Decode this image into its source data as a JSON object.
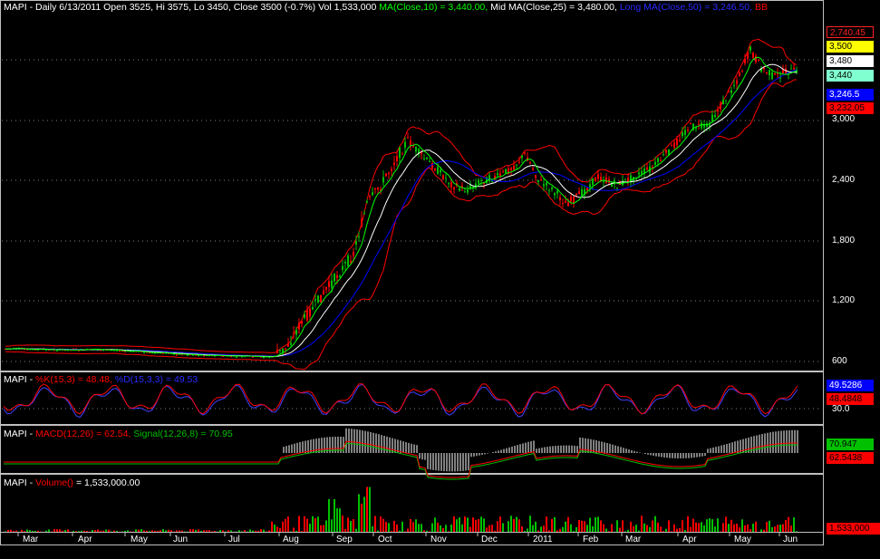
{
  "header_main": {
    "prefix": "MAPI - Daily 6/13/2011 Open 3525, Hi 3575, Lo 3450, Close 3500 (-0.7%) Vol 1,533,000 ",
    "ma_short": "MA(Close,10) = 3,440.00, ",
    "ma_mid": "Mid MA(Close,25) = 3,480.00, ",
    "ma_long": "Long MA(Close,50) = 3,246.50, ",
    "bb": "BB"
  },
  "header_stoch": {
    "prefix": "MAPI - ",
    "k": "%K(15,3) = 48.48, ",
    "d": "%D(15,3,3) = 49.53"
  },
  "header_macd": {
    "prefix": "MAPI - ",
    "macd": "MACD(12,26) = 62.54, ",
    "signal": "Signal(12,26,8) = 70.95"
  },
  "header_volume": {
    "prefix": "MAPI - ",
    "vol": "Volume() ",
    "val": "= 1,533,000.00"
  },
  "price_axis": {
    "ticks": [
      "3,000",
      "2,400",
      "1,800",
      "1,200",
      "600"
    ]
  },
  "price_tags": [
    "2,740.45",
    "3,500",
    "3,480",
    "3,440",
    "3,246.5",
    "3,232.05"
  ],
  "stoch_axis": {
    "tick": "30.0",
    "tags": [
      "49.5286",
      "48.4848"
    ]
  },
  "macd_tags": [
    "70.947",
    "62.5438"
  ],
  "volume_tag": "1,533,000",
  "time_axis": [
    "Mar",
    "Apr",
    "May",
    "Jun",
    "Jul",
    "Aug",
    "Sep",
    "Oct",
    "Nov",
    "Dec",
    "2011",
    "Feb",
    "Mar",
    "Apr",
    "May",
    "Jun"
  ],
  "colors": {
    "background": "#000000",
    "up_candle": "#00c000",
    "down_candle": "#ff0000",
    "ma_short": "#00ff00",
    "ma_mid": "#ffffff",
    "ma_long": "#0000ff",
    "bollinger": "#ff0000",
    "stoch_k": "#ff0000",
    "stoch_d": "#4040ff",
    "macd": "#ff0000",
    "signal": "#00c000"
  }
}
